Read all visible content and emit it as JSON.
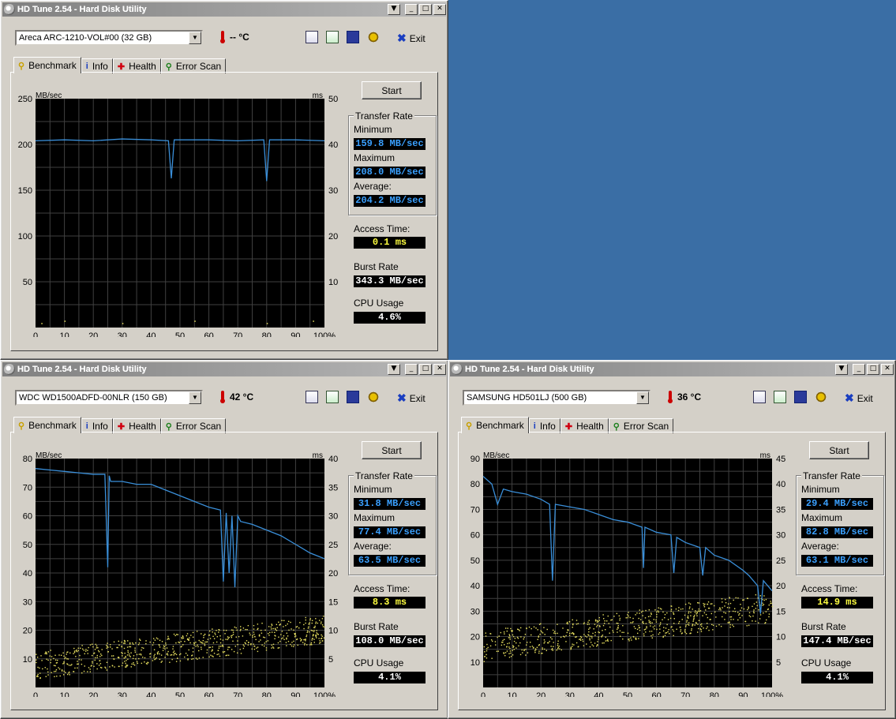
{
  "colors": {
    "desktop": "#3a6ea5",
    "chart_bg": "#000000",
    "grid": "#404040",
    "transfer_line": "#3a8fd9",
    "access_dots": "#e8e060",
    "min_max_avg": "#3aa0ff",
    "access_val": "#ffff40",
    "white_val": "#ffffff"
  },
  "windows": [
    {
      "title": "HD Tune 2.54 - Hard Disk Utility",
      "drive": "Areca  ARC-1210-VOL#00 (32 GB)",
      "temperature": "-- °C",
      "exit_label": "Exit",
      "tabs": [
        "Benchmark",
        "Info",
        "Health",
        "Error Scan"
      ],
      "start_label": "Start",
      "transfer_rate_title": "Transfer Rate",
      "minimum_label": "Minimum",
      "minimum": "159.8 MB/sec",
      "maximum_label": "Maximum",
      "maximum": "208.0 MB/sec",
      "average_label": "Average:",
      "average": "204.2 MB/sec",
      "access_label": "Access Time:",
      "access": "0.1 ms",
      "burst_label": "Burst Rate",
      "burst": "343.3 MB/sec",
      "cpu_label": "CPU Usage",
      "cpu": "4.6%",
      "chart_data": {
        "type": "line",
        "ylabel": "MB/sec",
        "y2label": "ms",
        "ylim": [
          0,
          250
        ],
        "y2lim": [
          0,
          50
        ],
        "yticks": [
          50,
          100,
          150,
          200,
          250
        ],
        "y2ticks": [
          10,
          20,
          30,
          40,
          50
        ],
        "xticks": [
          "0",
          "10",
          "20",
          "30",
          "40",
          "50",
          "60",
          "70",
          "80",
          "90",
          "100%"
        ],
        "series": [
          {
            "name": "Transfer Rate",
            "x": [
              0,
              10,
              20,
              30,
              40,
              46,
              47,
              48,
              60,
              70,
              79,
              80,
              81,
              90,
              100
            ],
            "values": [
              204,
              205,
              204,
              206,
              205,
              204,
              163,
              205,
              205,
              204,
              205,
              160,
              205,
              205,
              204
            ]
          }
        ],
        "access_points": [
          [
            2,
            1
          ],
          [
            10,
            1.5
          ],
          [
            30,
            1
          ],
          [
            55,
            1.5
          ],
          [
            80,
            1
          ],
          [
            96,
            1.5
          ]
        ]
      }
    },
    {
      "title": "HD Tune 2.54 - Hard Disk Utility",
      "drive": "WDC WD1500ADFD-00NLR (150 GB)",
      "temperature": "42 °C",
      "exit_label": "Exit",
      "tabs": [
        "Benchmark",
        "Info",
        "Health",
        "Error Scan"
      ],
      "start_label": "Start",
      "transfer_rate_title": "Transfer Rate",
      "minimum_label": "Minimum",
      "minimum": "31.8 MB/sec",
      "maximum_label": "Maximum",
      "maximum": "77.4 MB/sec",
      "average_label": "Average:",
      "average": "63.5 MB/sec",
      "access_label": "Access Time:",
      "access": "8.3 ms",
      "burst_label": "Burst Rate",
      "burst": "108.0 MB/sec",
      "cpu_label": "CPU Usage",
      "cpu": "4.1%",
      "chart_data": {
        "type": "line",
        "ylabel": "MB/sec",
        "y2label": "ms",
        "ylim": [
          0,
          80
        ],
        "y2lim": [
          0,
          40
        ],
        "yticks": [
          10,
          20,
          30,
          40,
          50,
          60,
          70,
          80
        ],
        "y2ticks": [
          5,
          10,
          15,
          20,
          25,
          30,
          35,
          40
        ],
        "xticks": [
          "0",
          "10",
          "20",
          "30",
          "40",
          "50",
          "60",
          "70",
          "80",
          "90",
          "100%"
        ],
        "series": [
          {
            "name": "Transfer Rate",
            "x": [
              0,
              5,
              10,
              15,
              20,
              24,
              25,
              25.5,
              26,
              30,
              35,
              40,
              45,
              50,
              55,
              60,
              64,
              65,
              66,
              67,
              68,
              69,
              70,
              71,
              75,
              80,
              85,
              90,
              95,
              100
            ],
            "values": [
              76.5,
              76,
              75.5,
              75,
              74.5,
              74.5,
              42,
              74,
              72,
              72,
              71,
              71,
              69,
              67,
              65,
              63,
              62,
              37,
              61,
              40,
              60,
              35,
              60,
              58,
              57,
              55,
              53,
              50,
              47,
              45
            ]
          }
        ],
        "access_seed": 11,
        "access_count": 700,
        "access_ms_range": [
          3,
          12
        ]
      }
    },
    {
      "title": "HD Tune 2.54 - Hard Disk Utility",
      "drive": "SAMSUNG HD501LJ (500 GB)",
      "temperature": "36 °C",
      "exit_label": "Exit",
      "tabs": [
        "Benchmark",
        "Info",
        "Health",
        "Error Scan"
      ],
      "start_label": "Start",
      "transfer_rate_title": "Transfer Rate",
      "minimum_label": "Minimum",
      "minimum": "29.4 MB/sec",
      "maximum_label": "Maximum",
      "maximum": "82.8 MB/sec",
      "average_label": "Average:",
      "average": "63.1 MB/sec",
      "access_label": "Access Time:",
      "access": "14.9 ms",
      "burst_label": "Burst Rate",
      "burst": "147.4 MB/sec",
      "cpu_label": "CPU Usage",
      "cpu": "4.1%",
      "chart_data": {
        "type": "line",
        "ylabel": "MB/sec",
        "y2label": "ms",
        "ylim": [
          0,
          90
        ],
        "y2lim": [
          0,
          45
        ],
        "yticks": [
          10,
          20,
          30,
          40,
          50,
          60,
          70,
          80,
          90
        ],
        "y2ticks": [
          5,
          10,
          15,
          20,
          25,
          30,
          35,
          40,
          45
        ],
        "xticks": [
          "0",
          "10",
          "20",
          "30",
          "40",
          "50",
          "60",
          "70",
          "80",
          "90",
          "100%"
        ],
        "series": [
          {
            "name": "Transfer Rate",
            "x": [
              0,
              3,
              5,
              7,
              10,
              15,
              20,
              23,
              24,
              25,
              30,
              35,
              40,
              45,
              50,
              55,
              55.5,
              56,
              60,
              65,
              66,
              67,
              70,
              75,
              76,
              77,
              80,
              85,
              90,
              92,
              95,
              96,
              97,
              100
            ],
            "values": [
              83,
              80,
              72,
              78,
              77,
              76,
              74,
              72,
              42,
              72,
              71,
              70,
              68,
              66,
              65,
              63,
              47,
              63,
              61,
              60,
              45,
              59,
              57,
              55,
              44,
              55,
              52,
              50,
              46,
              44,
              40,
              29,
              42,
              38
            ]
          }
        ],
        "access_seed": 23,
        "access_count": 650,
        "access_ms_range": [
          7,
          18
        ]
      }
    }
  ]
}
